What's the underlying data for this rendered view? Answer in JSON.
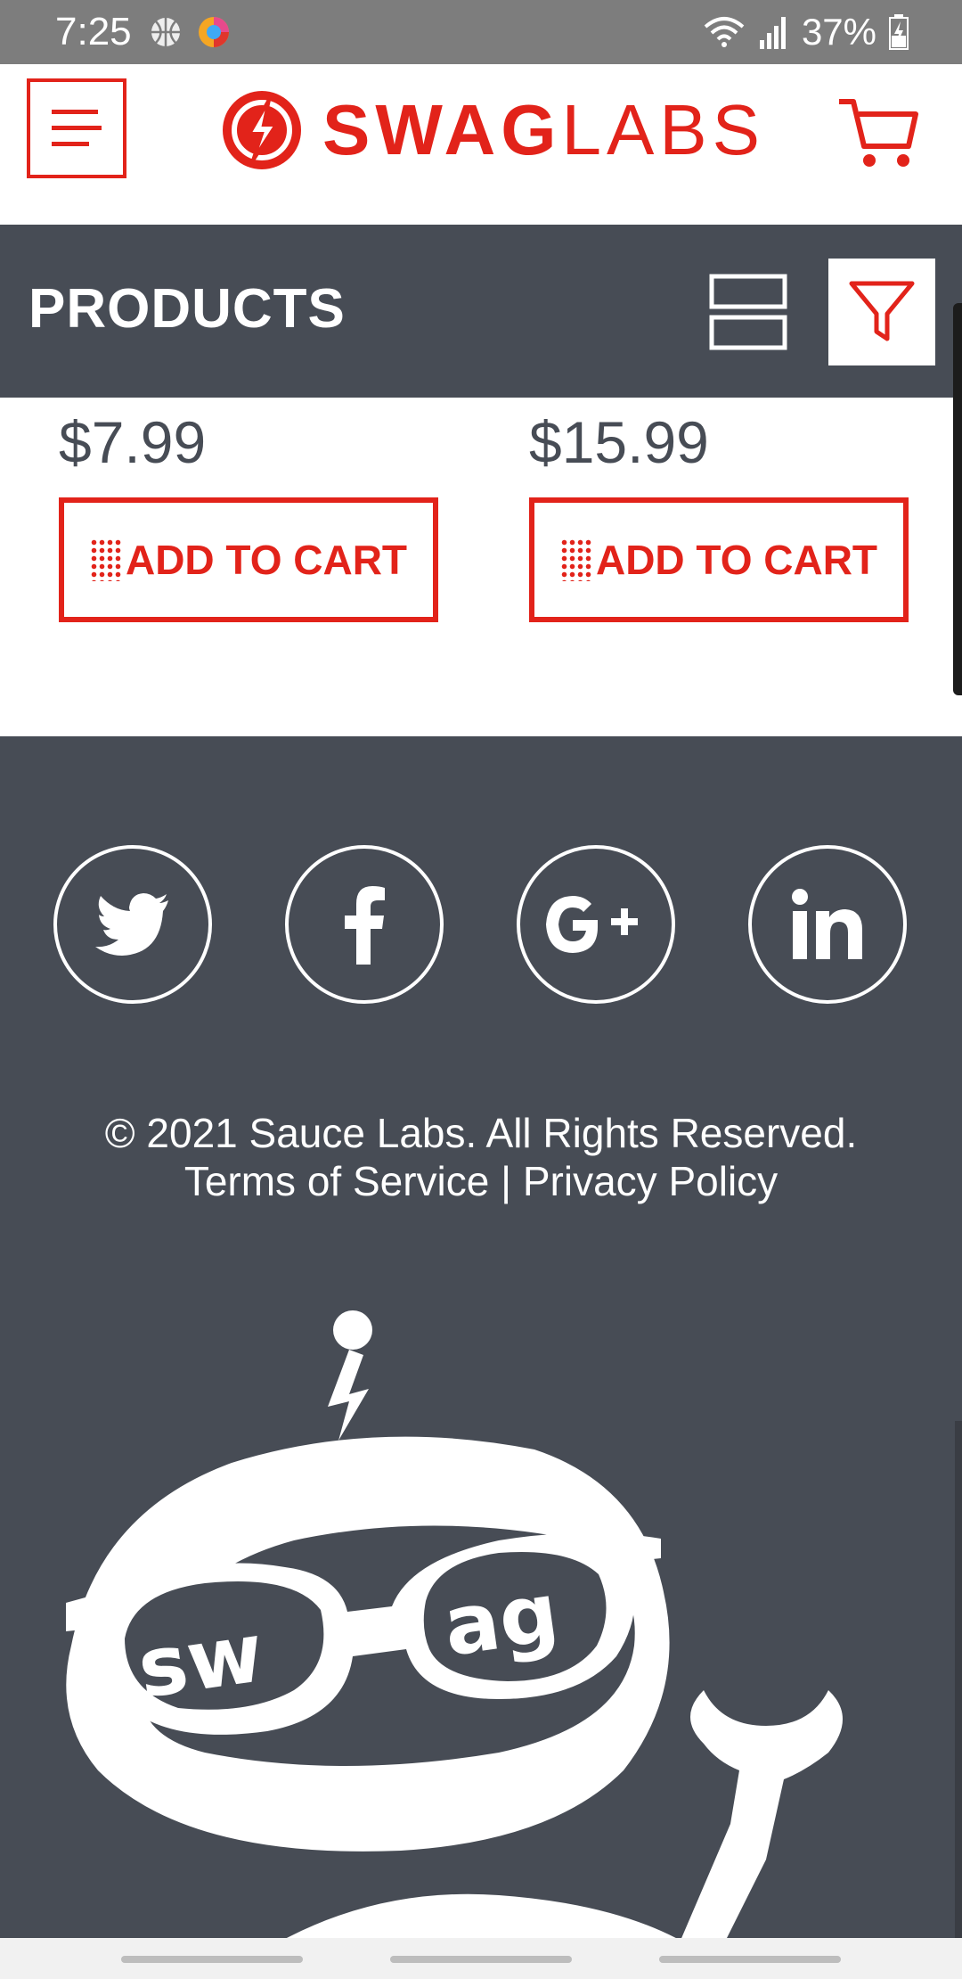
{
  "status_bar": {
    "time": "7:25",
    "battery": "37%",
    "icons": [
      "basketball-icon",
      "browser-app-icon",
      "wifi-icon",
      "signal-icon",
      "battery-charging-icon"
    ]
  },
  "header": {
    "brand_bold": "SWAG",
    "brand_light": "LABS",
    "menu_icon": "menu-icon",
    "cart_icon": "cart-icon"
  },
  "products_bar": {
    "title": "PRODUCTS",
    "layout_icon": "list-layout-icon",
    "filter_icon": "filter-icon"
  },
  "products": [
    {
      "price": "$7.99",
      "button_label": "ADD TO CART"
    },
    {
      "price": "$15.99",
      "button_label": "ADD TO CART"
    }
  ],
  "footer": {
    "social": [
      "twitter-icon",
      "facebook-icon",
      "google-plus-icon",
      "linkedin-icon"
    ],
    "copyright": "© 2021 Sauce Labs. All Rights Reserved.",
    "terms": "Terms of Service",
    "separator": "|",
    "privacy": "Privacy Policy",
    "mascot_text_left": "sw",
    "mascot_text_right": "ag"
  },
  "colors": {
    "brand_red": "#e2231a",
    "dark_slate": "#474c55",
    "status_gray": "#7d7d7d"
  }
}
